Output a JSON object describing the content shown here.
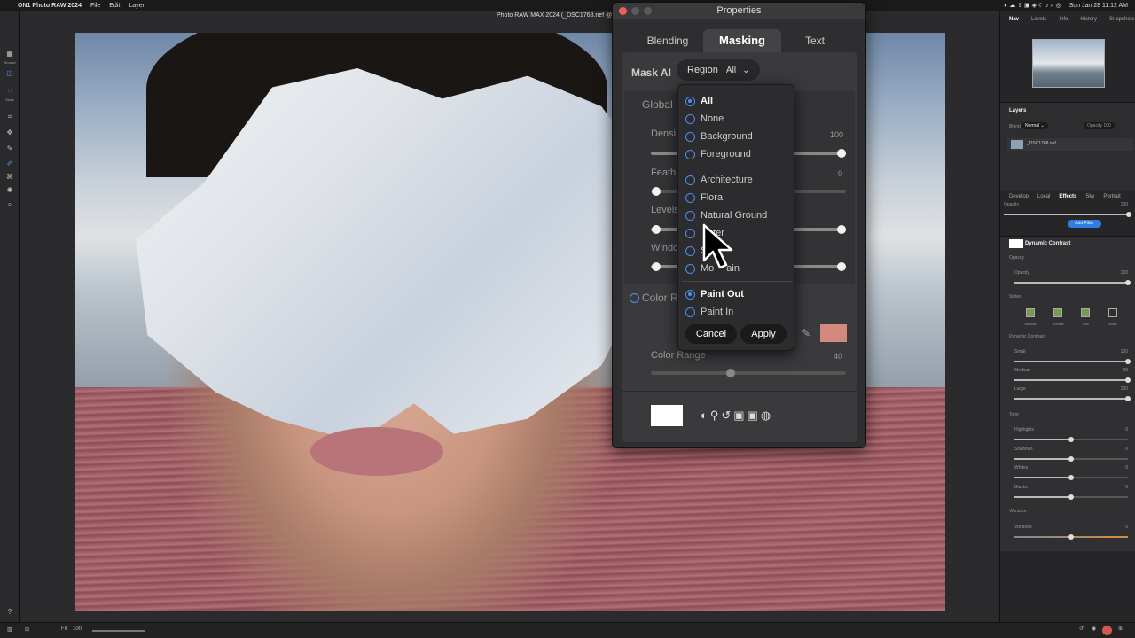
{
  "menubar": {
    "app_name": "ON1 Photo RAW 2024",
    "menus": [
      "File",
      "Edit",
      "Layer"
    ],
    "status_right": "Sun Jan 28  11:12 AM"
  },
  "window_title": "Photo RAW MAX 2024 (_DSC1768.nef @",
  "toolbar": {
    "labels": [
      "Browse",
      "Mask"
    ]
  },
  "properties": {
    "title": "Properties",
    "tabs": [
      "Blending",
      "Masking",
      "Text"
    ],
    "active_tab": "Masking",
    "mask_ai_label": "Mask AI",
    "region_label": "Region",
    "region_value": "All",
    "global_label": "Global",
    "density_label": "Densi",
    "density_value": "100",
    "feather_label": "Feath",
    "feather_value": "0",
    "levels_label": "Levels",
    "window_label": "Windo",
    "color_range_header": "Color R",
    "color_range_label": "Color Range",
    "color_range_value": "40",
    "swatch_color": "#d38a7c"
  },
  "dropdown": {
    "group1": [
      "All",
      "None",
      "Background",
      "Foreground"
    ],
    "group2": [
      "Architecture",
      "Flora",
      "Natural Ground",
      "Water",
      "Sky",
      "Mountain"
    ],
    "group2_visible": [
      "Architecture",
      "Flora",
      "Natural Ground",
      "ater",
      "S",
      "Mo",
      "ain"
    ],
    "group3": [
      "Paint Out",
      "Paint In"
    ],
    "selected": "All",
    "selected_mode": "Paint Out",
    "cancel_label": "Cancel",
    "apply_label": "Apply"
  },
  "right_panel": {
    "top_tabs": [
      "Nav",
      "Levels",
      "Info",
      "History",
      "Snapshots"
    ],
    "layers_header": "Layers",
    "blend_label": "Blend",
    "blend_value": "Normal",
    "opacity_label": "Opacity",
    "opacity_value": "100",
    "layer_name": "_DSC1768.nef",
    "module_tabs": [
      "Develop",
      "Local",
      "Effects",
      "Sky",
      "Portrait"
    ],
    "active_module": "Effects",
    "effects_opacity_label": "Opacity",
    "effects_opacity_value": "100",
    "add_filter_label": "Add Filter",
    "filter_name": "Dynamic Contrast",
    "opacity_section": "Opacity",
    "opacity_slider_label": "Opacity",
    "opacity_slider_value": "100",
    "styles_label": "Styles",
    "styles": [
      "Natural",
      "Surreal",
      "Soft",
      "More"
    ],
    "dc_section": "Dynamic Contrast",
    "dc_sliders": [
      {
        "label": "Small",
        "value": "100",
        "level": 1.0
      },
      {
        "label": "Medium",
        "value": "99",
        "level": 1.0
      },
      {
        "label": "Large",
        "value": "100",
        "level": 1.0
      }
    ],
    "tone_section": "Tone",
    "tone_sliders": [
      {
        "label": "Highlights",
        "value": "0",
        "level": 0.5
      },
      {
        "label": "Shadows",
        "value": "0",
        "level": 0.5
      },
      {
        "label": "Whites",
        "value": "0",
        "level": 0.5
      },
      {
        "label": "Blacks",
        "value": "0",
        "level": 0.5
      }
    ],
    "vibrance_section": "Vibrance",
    "vibrance_label": "Vibrance",
    "vibrance_value": "0"
  },
  "bottombar": {
    "fit_label": "Fit",
    "zoom_value": "100"
  },
  "colors": {
    "accent_blue": "#4f8fe8",
    "water_mask": "#a5616a"
  }
}
